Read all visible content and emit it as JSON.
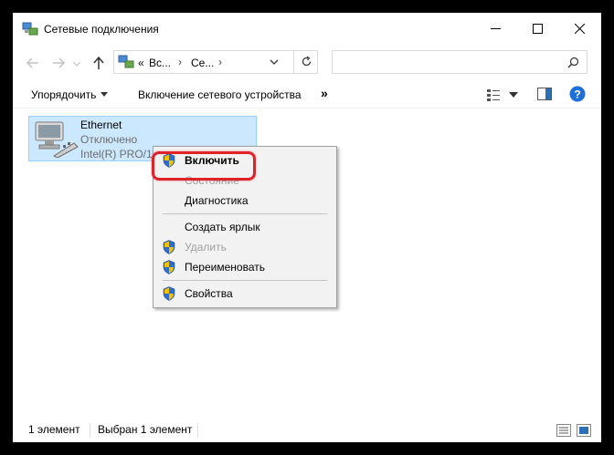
{
  "window": {
    "title": "Сетевые подключения",
    "controls": [
      "minimize",
      "maximize",
      "close"
    ]
  },
  "address_bar": {
    "crumbs": [
      "Вс...",
      "Се..."
    ],
    "prefix": "«",
    "separator": "›",
    "search_placeholder": ""
  },
  "command_bar": {
    "organize": "Упорядочить",
    "enable_device": "Включение сетевого устройства",
    "more": "»"
  },
  "items": [
    {
      "name": "Ethernet",
      "status": "Отключено",
      "device": "Intel(R) PRO/1000 MT Desktop Adapter"
    }
  ],
  "context_menu": {
    "items": [
      {
        "label": "Включить",
        "shield": true,
        "bold": true,
        "disabled": false
      },
      {
        "label": "Состояние",
        "shield": false,
        "bold": false,
        "disabled": true
      },
      {
        "label": "Диагностика",
        "shield": false,
        "bold": false,
        "disabled": false
      },
      {
        "label": "Создать ярлык",
        "shield": false,
        "bold": false,
        "disabled": false
      },
      {
        "label": "Удалить",
        "shield": true,
        "bold": false,
        "disabled": true
      },
      {
        "label": "Переименовать",
        "shield": true,
        "bold": false,
        "disabled": false
      },
      {
        "label": "Свойства",
        "shield": true,
        "bold": false,
        "disabled": false
      }
    ]
  },
  "status_bar": {
    "count": "1 элемент",
    "selected": "Выбран 1 элемент"
  },
  "colors": {
    "selection_bg": "#cce8ff",
    "selection_border": "#99d1ff",
    "highlight_ring": "#e0232a",
    "help_blue": "#1e6fd9"
  }
}
